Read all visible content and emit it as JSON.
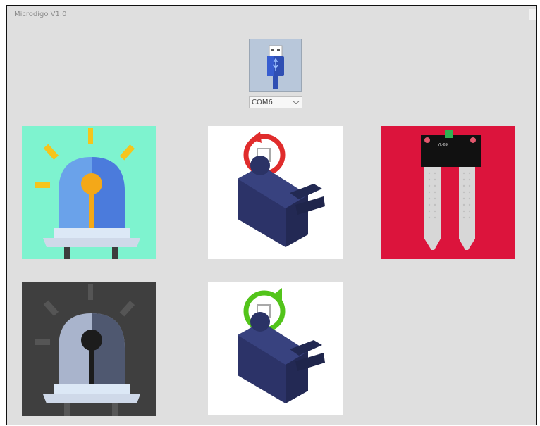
{
  "window": {
    "title": "Microdigo V1.0"
  },
  "connection": {
    "port_selected": "COM6",
    "port_options": [
      "COM6"
    ]
  },
  "tiles": [
    {
      "icon": "warning-light-on-icon"
    },
    {
      "icon": "servo-rotate-clockwise-icon"
    },
    {
      "icon": "soil-moisture-sensor-icon"
    },
    {
      "icon": "warning-light-off-icon"
    },
    {
      "icon": "servo-rotate-counterclockwise-icon"
    }
  ],
  "sensor": {
    "board_label": "YL-69"
  },
  "colors": {
    "window_bg": "#dfdfdf",
    "light_on_bg": "#7ef3cf",
    "light_off_bg": "#3f3f3f",
    "sensor_bg": "#dc143c",
    "servo_body": "#2c3368",
    "rotate_cw": "#e02c2c",
    "rotate_ccw": "#52c41a"
  }
}
